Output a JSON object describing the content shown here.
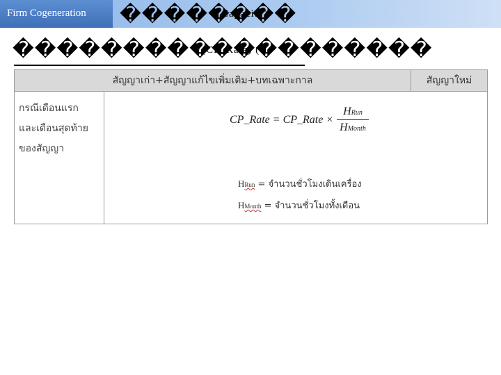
{
  "header": {
    "brand": "Firm Cogeneration",
    "title_line1_glyphs": "��������",
    "title_line1_suffix": "(Capacity)"
  },
  "subtitle": {
    "glyphs": "�������������������",
    "inline_text": "(CP_Rate) (    )"
  },
  "table": {
    "col1_header": "สัญญาเก่า+สัญญาแก้ไขเพิ่มเติม+บทเฉพาะกาล",
    "col2_header": "สัญญาใหม่",
    "row_label": [
      "กรณีเดือนแรก",
      "และเดือนสุดท้าย",
      "ของสัญญา"
    ],
    "formula_lhs": "CP_Rate = CP_Rate ×",
    "frac_num": "H",
    "frac_num_sub": "Run",
    "frac_den": "H",
    "frac_den_sub": "Month",
    "def1_sub": "Run",
    "def1_text": " = จำนวนชั่วโมงเดินเครื่อง",
    "def2_sub": "Month",
    "def2_text": " = จำนวนชั่วโมงทั้งเดือน",
    "def_h": "H"
  }
}
